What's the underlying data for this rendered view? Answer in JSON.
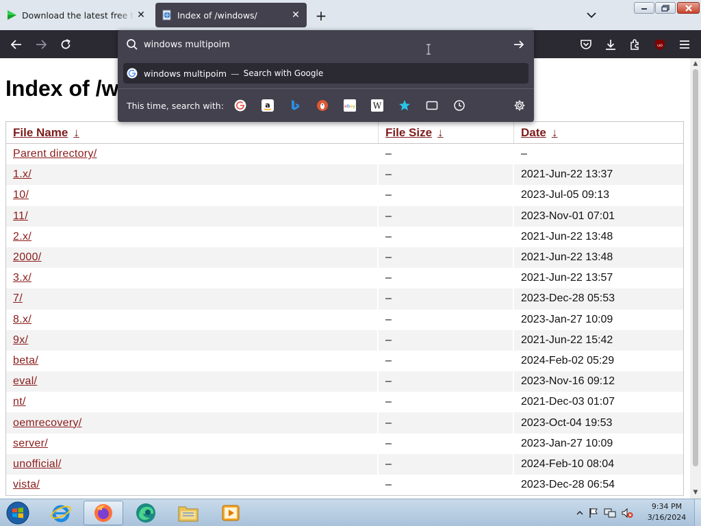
{
  "tabs": [
    {
      "title": "Download the latest free trial ve",
      "active": false,
      "icon": "green-play-icon"
    },
    {
      "title": "Index of /windows/",
      "active": true,
      "icon": "globe-doc-icon"
    }
  ],
  "urlbar": {
    "value": "windows multipoim",
    "suggestion": {
      "text": "windows multipoim",
      "separator": "—",
      "action": "Search with Google"
    },
    "search_with_label": "This time, search with:",
    "engines": [
      "google",
      "amazon",
      "bing",
      "duckduckgo",
      "ebay",
      "wikipedia",
      "bookmarks",
      "tabs",
      "history"
    ]
  },
  "page": {
    "title": "Index of /windows/",
    "columns": [
      {
        "label": "File Name",
        "sort_arrow": "↓"
      },
      {
        "label": "File Size",
        "sort_arrow": "↓"
      },
      {
        "label": "Date",
        "sort_arrow": "↓"
      }
    ],
    "rows": [
      {
        "name": "Parent directory/",
        "size": "–",
        "date": "–"
      },
      {
        "name": "1.x/",
        "size": "–",
        "date": "2021-Jun-22 13:37"
      },
      {
        "name": "10/",
        "size": "–",
        "date": "2023-Jul-05 09:13"
      },
      {
        "name": "11/",
        "size": "–",
        "date": "2023-Nov-01 07:01"
      },
      {
        "name": "2.x/",
        "size": "–",
        "date": "2021-Jun-22 13:48"
      },
      {
        "name": "2000/",
        "size": "–",
        "date": "2021-Jun-22 13:48"
      },
      {
        "name": "3.x/",
        "size": "–",
        "date": "2021-Jun-22 13:57"
      },
      {
        "name": "7/",
        "size": "–",
        "date": "2023-Dec-28 05:53"
      },
      {
        "name": "8.x/",
        "size": "–",
        "date": "2023-Jan-27 10:09"
      },
      {
        "name": "9x/",
        "size": "–",
        "date": "2021-Jun-22 15:42"
      },
      {
        "name": "beta/",
        "size": "–",
        "date": "2024-Feb-02 05:29"
      },
      {
        "name": "eval/",
        "size": "–",
        "date": "2023-Nov-16 09:12"
      },
      {
        "name": "nt/",
        "size": "–",
        "date": "2021-Dec-03 01:07"
      },
      {
        "name": "oemrecovery/",
        "size": "–",
        "date": "2023-Oct-04 19:53"
      },
      {
        "name": "server/",
        "size": "–",
        "date": "2023-Jan-27 10:09"
      },
      {
        "name": "unofficial/",
        "size": "–",
        "date": "2024-Feb-10 08:04"
      },
      {
        "name": "vista/",
        "size": "–",
        "date": "2023-Dec-28 06:54"
      }
    ]
  },
  "taskbar": {
    "apps": [
      "internet-explorer",
      "firefox",
      "edge",
      "file-explorer",
      "media-player"
    ],
    "active_app": "firefox",
    "clock": {
      "time": "9:34 PM",
      "date": "3/16/2024"
    }
  },
  "colors": {
    "toolbar_dark": "#2b2a33",
    "panel": "#42414d",
    "link": "#8b1a1a",
    "heading_link": "#7d1b1b"
  }
}
